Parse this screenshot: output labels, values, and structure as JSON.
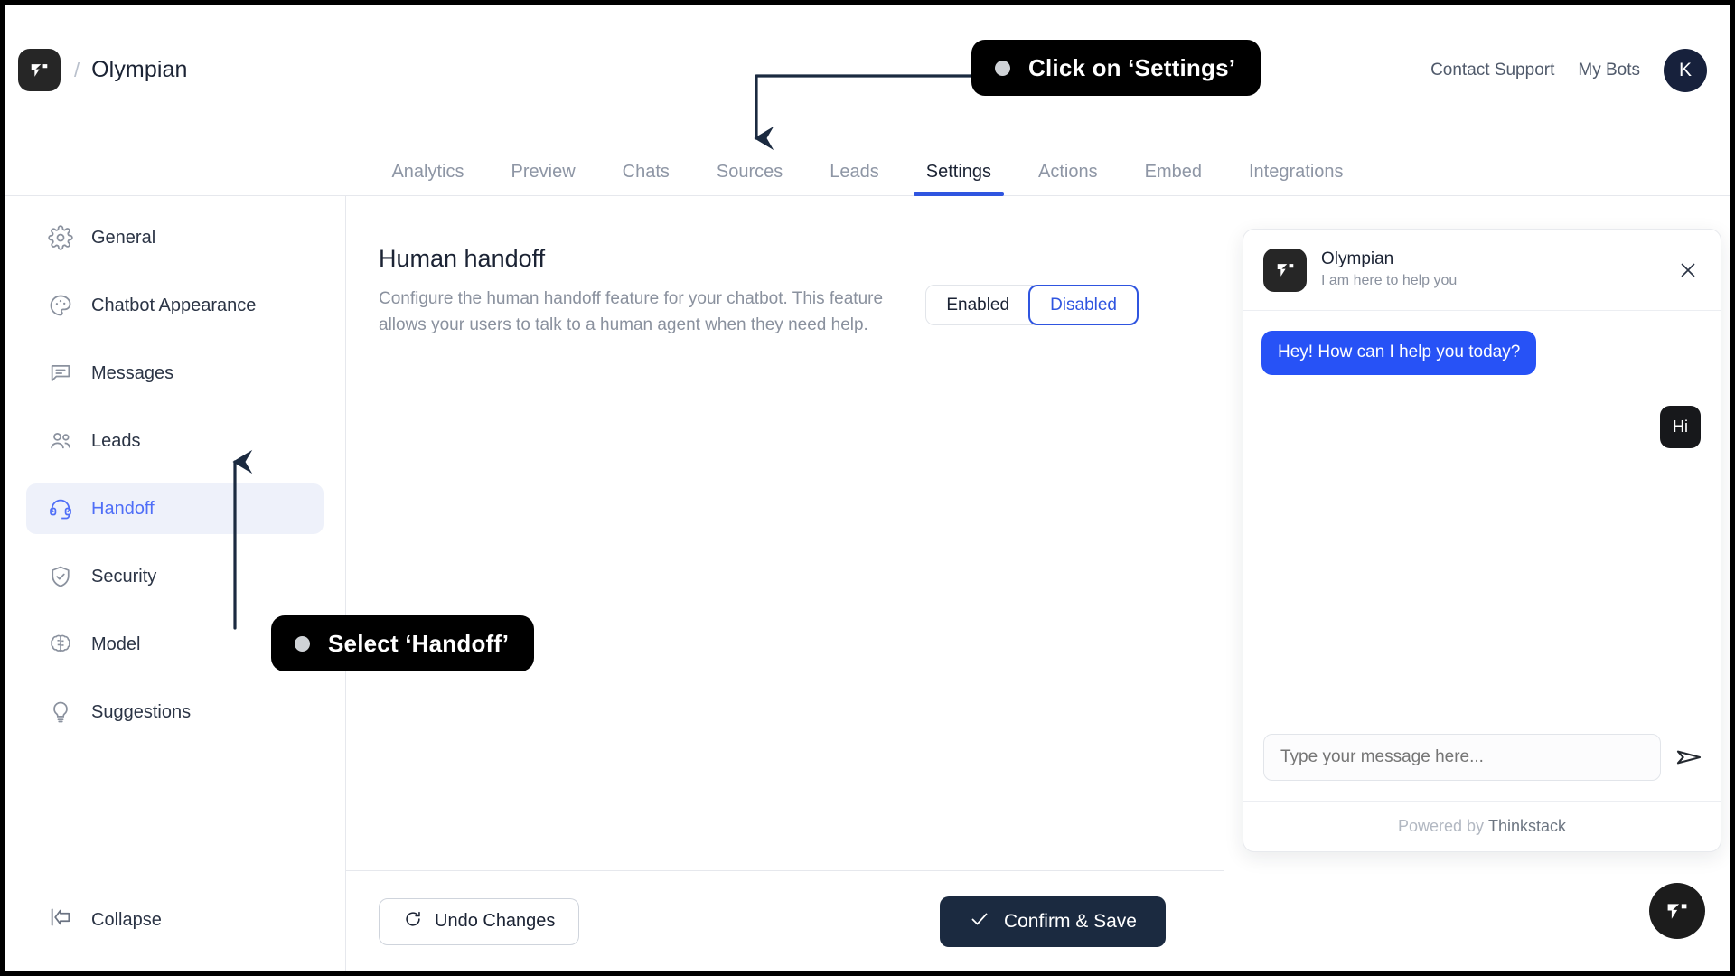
{
  "header": {
    "brand_name": "Olympian",
    "separator": "/",
    "logo_icon": "thinkstack-logo-icon",
    "links": [
      {
        "label": "Contact Support",
        "name": "contact-support-link"
      },
      {
        "label": "My Bots",
        "name": "my-bots-link"
      }
    ],
    "avatar_initial": "K",
    "avatar_color": "#17213c"
  },
  "nav": {
    "active": "Settings",
    "tabs": [
      {
        "label": "Analytics"
      },
      {
        "label": "Preview"
      },
      {
        "label": "Chats"
      },
      {
        "label": "Sources"
      },
      {
        "label": "Leads"
      },
      {
        "label": "Settings"
      },
      {
        "label": "Actions"
      },
      {
        "label": "Embed"
      },
      {
        "label": "Integrations"
      }
    ],
    "active_underline_color": "#2f55e0"
  },
  "sidebar": {
    "active": "Handoff",
    "active_bg": "#eef1fa",
    "active_color": "#4f6ef7",
    "items": [
      {
        "label": "General",
        "icon": "gear-icon"
      },
      {
        "label": "Chatbot Appearance",
        "icon": "palette-icon"
      },
      {
        "label": "Messages",
        "icon": "message-icon"
      },
      {
        "label": "Leads",
        "icon": "users-icon"
      },
      {
        "label": "Handoff",
        "icon": "headset-icon"
      },
      {
        "label": "Security",
        "icon": "shield-check-icon"
      },
      {
        "label": "Model",
        "icon": "brain-icon"
      },
      {
        "label": "Suggestions",
        "icon": "lightbulb-icon"
      }
    ],
    "collapse": {
      "label": "Collapse",
      "icon": "collapse-left-icon"
    }
  },
  "main": {
    "title": "Human handoff",
    "description": "Configure the human handoff feature for your chatbot. This feature allows your users to talk to a human agent when they need help.",
    "toggle": {
      "selected": "Disabled",
      "options": [
        {
          "label": "Enabled"
        },
        {
          "label": "Disabled"
        }
      ],
      "active_color": "#2f55e0"
    },
    "footer": {
      "undo_label": "Undo Changes",
      "undo_icon": "refresh-icon",
      "save_label": "Confirm & Save",
      "save_icon": "check-icon",
      "save_bg": "#1b2a40"
    }
  },
  "chat_widget": {
    "bot_name": "Olympian",
    "bot_tagline": "I am here to help you",
    "logo_icon": "thinkstack-logo-icon",
    "close_icon": "close-icon",
    "messages": [
      {
        "from": "bot",
        "text": "Hey! How can I help you today?"
      },
      {
        "from": "user",
        "text": "Hi"
      }
    ],
    "bot_bubble_color": "#2752f6",
    "user_bubble_color": "#17181b",
    "input_placeholder": "Type your message here...",
    "input_value": "",
    "send_icon": "send-icon",
    "footer_prefix": "Powered by",
    "footer_brand": "Thinkstack",
    "launcher_icon": "thinkstack-logo-icon"
  },
  "annotations": [
    {
      "text": "Click on ‘Settings’",
      "name": "callout-settings"
    },
    {
      "text": "Select ‘Handoff’",
      "name": "callout-handoff"
    }
  ]
}
